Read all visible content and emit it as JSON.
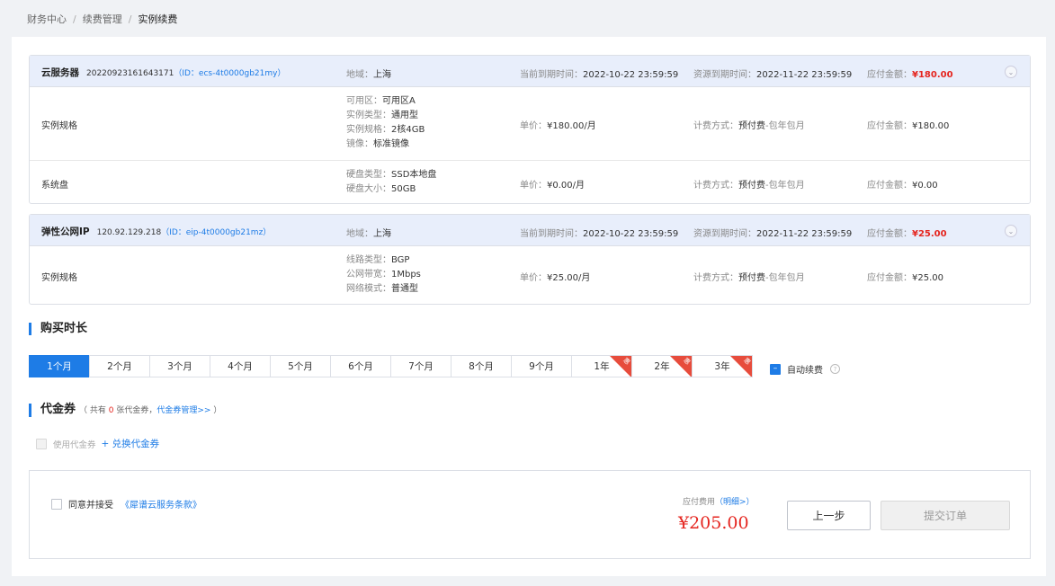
{
  "breadcrumb": {
    "items": [
      "财务中心",
      "续费管理"
    ],
    "current": "实例续费",
    "separator": "/"
  },
  "products": [
    {
      "name": "云服务器",
      "instance_id": "20220923161643171",
      "id_label": "（ID：ecs-4t0000gb21my）",
      "region_label": "地域：",
      "region": "上海",
      "cur_expire_label": "当前到期时间：",
      "cur_expire": "2022-10-22 23:59:59",
      "res_expire_label": "资源到期时间：",
      "res_expire": "2022-11-22 23:59:59",
      "amount_label": "应付金额：",
      "amount": "¥180.00",
      "rows": [
        {
          "name": "实例规格",
          "specs": [
            {
              "k": "可用区：",
              "v": "可用区A"
            },
            {
              "k": "实例类型：",
              "v": "通用型"
            },
            {
              "k": "实例规格：",
              "v": "2核4GB"
            },
            {
              "k": "镜像：",
              "v": "标准镜像"
            }
          ],
          "price_label": "单价：",
          "price": "¥180.00/月",
          "billing_label": "计费方式：",
          "billing_main": "预付费",
          "billing_sub": "-包年包月",
          "amount_label": "应付金额：",
          "amount": "¥180.00"
        },
        {
          "name": "系统盘",
          "specs": [
            {
              "k": "硬盘类型：",
              "v": "SSD本地盘"
            },
            {
              "k": "硬盘大小：",
              "v": "50GB"
            }
          ],
          "price_label": "单价：",
          "price": "¥0.00/月",
          "billing_label": "计费方式：",
          "billing_main": "预付费",
          "billing_sub": "-包年包月",
          "amount_label": "应付金额：",
          "amount": "¥0.00"
        }
      ]
    },
    {
      "name": "弹性公网IP",
      "instance_id": "120.92.129.218",
      "id_label": "（ID：eip-4t0000gb21mz）",
      "region_label": "地域：",
      "region": "上海",
      "cur_expire_label": "当前到期时间：",
      "cur_expire": "2022-10-22 23:59:59",
      "res_expire_label": "资源到期时间：",
      "res_expire": "2022-11-22 23:59:59",
      "amount_label": "应付金额：",
      "amount": "¥25.00",
      "rows": [
        {
          "name": "实例规格",
          "specs": [
            {
              "k": "线路类型：",
              "v": "BGP"
            },
            {
              "k": "公网带宽：",
              "v": "1Mbps"
            },
            {
              "k": "网络模式：",
              "v": "普通型"
            }
          ],
          "price_label": "单价：",
          "price": "¥25.00/月",
          "billing_label": "计费方式：",
          "billing_main": "预付费",
          "billing_sub": "-包年包月",
          "amount_label": "应付金额：",
          "amount": "¥25.00"
        }
      ]
    }
  ],
  "duration": {
    "title": "购买时长",
    "options": [
      "1个月",
      "2个月",
      "3个月",
      "4个月",
      "5个月",
      "6个月",
      "7个月",
      "8个月",
      "9个月",
      "1年",
      "2年",
      "3年"
    ],
    "selected_index": 0,
    "discount_badge": "惠",
    "auto_renew_label": "自动续费",
    "auto_renew_checked": true,
    "help_icon": "?"
  },
  "voucher": {
    "title": "代金券",
    "note_prefix": "（ 共有 ",
    "count": "0",
    "note_mid": " 张代金券，",
    "manage_link": "代金券管理>>",
    "note_suffix": " ）",
    "use_label": "使用代金券",
    "exchange_link": "+ 兑换代金券"
  },
  "footer": {
    "agree_label": "同意并接受",
    "terms_link": "《犀谱云服务条款》",
    "fee_label": "应付费用",
    "detail_link": "（明细>）",
    "total": "¥205.00",
    "prev_button": "上一步",
    "submit_button": "提交订单"
  },
  "colors": {
    "accent": "#1e7ce6",
    "price_red": "#e5251f",
    "header_bg": "#e8eefb"
  }
}
